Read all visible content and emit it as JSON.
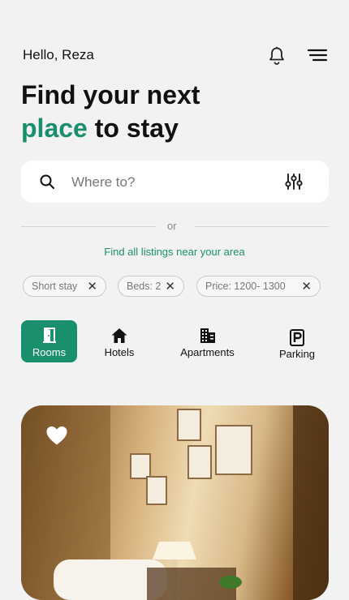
{
  "header": {
    "greeting": "Hello, Reza",
    "icons": [
      "bell-icon",
      "menu-icon"
    ]
  },
  "headline": {
    "line1": "Find your next",
    "accent": "place",
    "rest": " to stay"
  },
  "search": {
    "placeholder": "Where to?",
    "value": "",
    "icons": [
      "search-icon",
      "filter-sliders-icon"
    ]
  },
  "divider_text": "or",
  "near_link": "Find all listings near your area",
  "filters": [
    {
      "label": "Short stay"
    },
    {
      "label": "Beds: 2"
    },
    {
      "label": "Price: 1200- 1300"
    }
  ],
  "categories": [
    {
      "label": "Rooms",
      "icon": "door-icon",
      "active": true
    },
    {
      "label": "Hotels",
      "icon": "home-icon",
      "active": false
    },
    {
      "label": "Apartments",
      "icon": "building-icon",
      "active": false
    },
    {
      "label": "Parking",
      "icon": "parking-icon",
      "active": false
    }
  ],
  "colors": {
    "accent": "#1a8f6e",
    "background": "#f2f2f2"
  },
  "listing_card": {
    "image": "hotel-room-photo",
    "favorite_icon": "heart-icon"
  }
}
